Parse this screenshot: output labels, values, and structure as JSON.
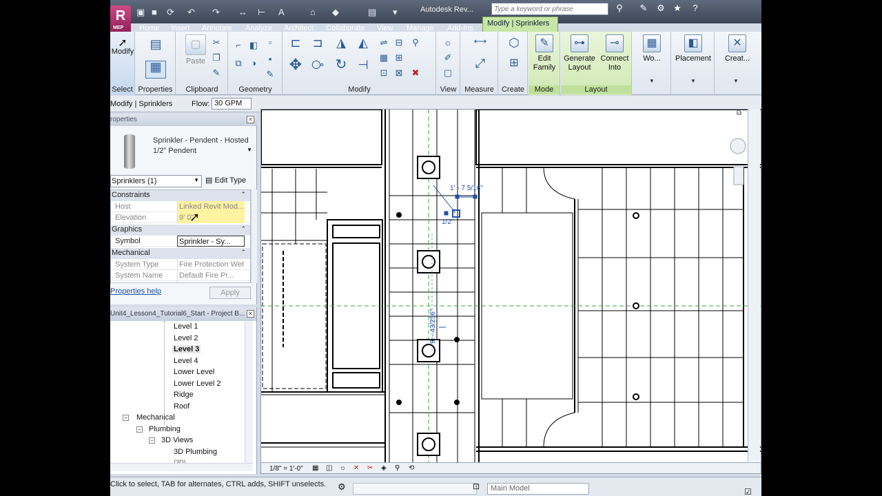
{
  "app": {
    "title": "Autodesk Rev...",
    "logo_letter": "R",
    "logo_sub": "MEP",
    "search_placeholder": "Type a keyword or phrase"
  },
  "tabs": [
    "Home",
    "Insert",
    "Annotate",
    "Analyze",
    "Architect",
    "Collaborate",
    "View",
    "Manage",
    "Add-Ins"
  ],
  "active_tab": "Modify | Sprinklers",
  "ribbon": {
    "panels": {
      "select": "Select",
      "properties": "Properties",
      "clipboard": "Clipboard",
      "geometry": "Geometry",
      "modify": "Modify",
      "view": "View",
      "measure": "Measure",
      "create": "Create",
      "mode": "Mode",
      "layout": "Layout"
    },
    "buttons": {
      "modify": "Modify",
      "paste": "Paste",
      "edit_family_1": "Edit",
      "edit_family_2": "Family",
      "generate_1": "Generate",
      "generate_2": "Layout",
      "connect_1": "Connect",
      "connect_2": "Into",
      "work": "Wo...",
      "placement": "Placement",
      "create": "Creat..."
    }
  },
  "options_bar": {
    "context": "Modify | Sprinklers",
    "flow_label": "Flow:",
    "flow_value": "30 GPM"
  },
  "properties": {
    "header": "roperties",
    "type_name": "Sprinkler - Pendent - Hosted",
    "type_sub": "1/2\" Pendent",
    "instance_filter": "Sprinklers (1)",
    "edit_type": "Edit Type",
    "sections": [
      {
        "title": "Constraints",
        "rows": [
          {
            "key": "Host",
            "value": "Linked Revit Mod..."
          },
          {
            "key": "Elevation",
            "value": "9'  0\""
          }
        ]
      },
      {
        "title": "Graphics",
        "rows": [
          {
            "key": "Symbol",
            "value": "Sprinkler - Sy..."
          }
        ]
      },
      {
        "title": "Mechanical",
        "rows": [
          {
            "key": "System Type",
            "value": "Fire Protection Wet"
          },
          {
            "key": "System Name",
            "value": "Default Fire Pr..."
          },
          {
            "key": "Pressure D...",
            "value": ""
          }
        ]
      }
    ],
    "help_link": "Properties help",
    "apply_label": "Apply"
  },
  "project_browser": {
    "header": "Unit4_Lesson4_Tutorial6_Start - Project B...",
    "levels": [
      "Level 1",
      "Level 2",
      "Level 3",
      "Level 4",
      "Lower Level",
      "Lower Level 2",
      "Ridge",
      "Roof"
    ],
    "active_level": "Level 3",
    "mechanical": "Mechanical",
    "plumbing": "Plumbing",
    "views_3d": "3D Views",
    "plumbing_3d": "3D Plumbing",
    "next_partial": "{3D}"
  },
  "drawing": {
    "dim_horizontal": "1' - 7 5/16\"",
    "dim_small": "1/2\"",
    "dim_vertical": "9' - 43/256\"",
    "scale": "1/8\" = 1'-0\""
  },
  "status": {
    "hint": "Click to select, TAB for alternates, CTRL adds, SHIFT unselects.",
    "model": "Main Model"
  },
  "colors": {
    "accent_tab": "#c8e6a8",
    "dimension_blue": "#1f4fa8",
    "guide_green": "#3aaa3a",
    "link_blue": "#1c55a8"
  }
}
